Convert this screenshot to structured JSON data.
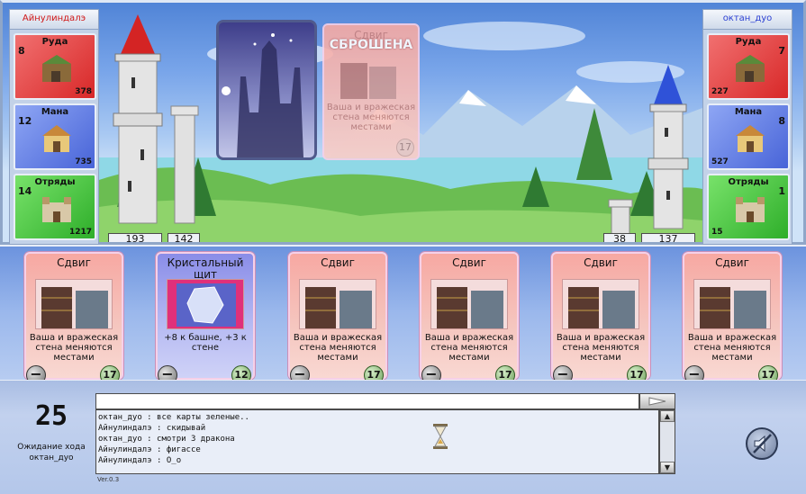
{
  "players": {
    "left": {
      "name": "Айнулиндалэ",
      "resources": [
        {
          "label": "Руда",
          "production": "8",
          "amount": "378",
          "color": "red",
          "icon": "quarry-icon"
        },
        {
          "label": "Мана",
          "production": "12",
          "amount": "735",
          "color": "blue",
          "icon": "magic-temple-icon"
        },
        {
          "label": "Отряды",
          "production": "14",
          "amount": "1217",
          "color": "green",
          "icon": "barracks-icon"
        }
      ],
      "tower_hp": "193",
      "wall_hp": "142"
    },
    "right": {
      "name": "октан_дуо",
      "resources": [
        {
          "label": "Руда",
          "production": "7",
          "amount": "227",
          "color": "red",
          "icon": "quarry-icon"
        },
        {
          "label": "Мана",
          "production": "8",
          "amount": "527",
          "color": "blue",
          "icon": "magic-temple-icon"
        },
        {
          "label": "Отряды",
          "production": "1",
          "amount": "15",
          "color": "green",
          "icon": "barracks-icon"
        }
      ],
      "tower_hp": "137",
      "wall_hp": "38"
    }
  },
  "played_card": {
    "title": "Сдвиг",
    "status": "СБРОШЕНА",
    "description": "Ваша и вражеская стена меняются местами",
    "cost": "17"
  },
  "deck_label": "deck-card-back",
  "hand": [
    {
      "title": "Сдвиг",
      "description": "Ваша и вражеская стена меняются местами",
      "cost": "17",
      "color": "red",
      "discard": "−"
    },
    {
      "title": "Кристальный щит",
      "description": "+8 к башне, +3 к стене",
      "cost": "12",
      "color": "blue",
      "discard": "−"
    },
    {
      "title": "Сдвиг",
      "description": "Ваша и вражеская стена меняются местами",
      "cost": "17",
      "color": "red",
      "discard": "−"
    },
    {
      "title": "Сдвиг",
      "description": "Ваша и вражеская стена меняются местами",
      "cost": "17",
      "color": "red",
      "discard": "−"
    },
    {
      "title": "Сдвиг",
      "description": "Ваша и вражеская стена меняются местами",
      "cost": "17",
      "color": "red",
      "discard": "−"
    },
    {
      "title": "Сдвиг",
      "description": "Ваша и вражеская стена меняются местами",
      "cost": "17",
      "color": "red",
      "discard": "−"
    }
  ],
  "status": {
    "turn_timer": "25",
    "waiting_line1": "Ожидание хода",
    "waiting_line2": "октан_дуо"
  },
  "chat": {
    "input_value": "",
    "lines": [
      "октан_дуо : все карты зеленые..",
      "Айнулиндалэ : скидывай",
      "октан_дуо : смотри 3 дракона",
      "Айнулиндалэ : фигассе",
      "Айнулиндалэ : О_о"
    ],
    "scroll_up": "▲",
    "scroll_down": "▼"
  },
  "version": "Ver.0.3",
  "colors": {
    "red_tower_roof": "#d42424",
    "blue_tower_roof": "#2f52d8",
    "card_red": "#f7a8a2",
    "card_blue": "#8a8de8"
  }
}
